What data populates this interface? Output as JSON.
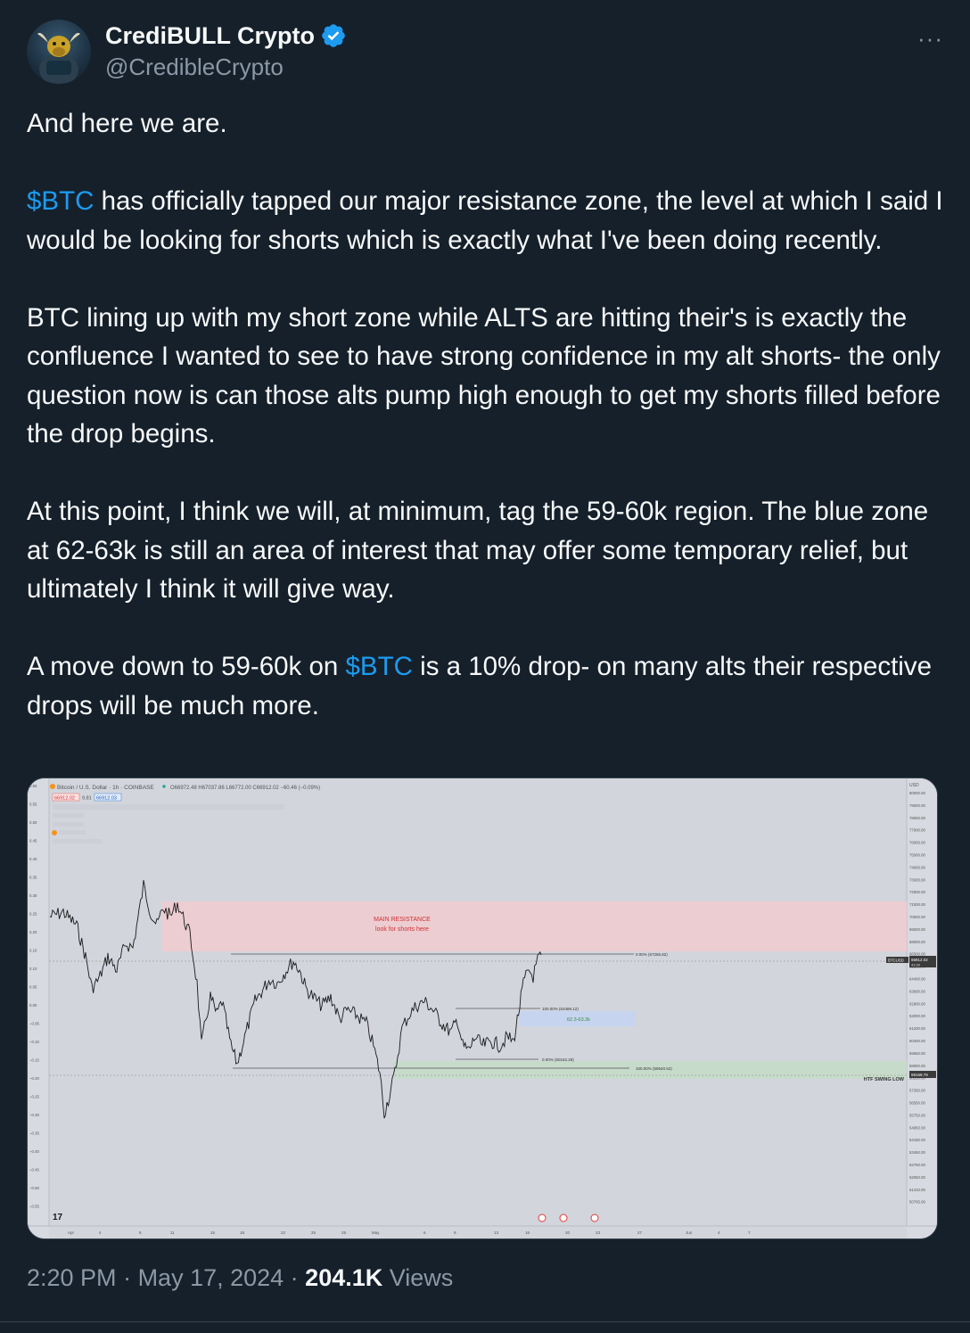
{
  "author": {
    "display_name": "CrediBULL Crypto",
    "handle": "@CredibleCrypto",
    "more_label": "···"
  },
  "tweet": {
    "p1": "And here we are.",
    "p2_tag": "$BTC",
    "p2_rest": " has officially tapped our major resistance zone, the level at which I said I would be looking for shorts which is exactly what I've been doing recently.",
    "p3": "BTC lining up with my short zone while ALTS are hitting their's is exactly the confluence I wanted to see to have strong confidence in my alt shorts- the only question now is can those alts pump high enough to get my shorts filled before the drop begins.",
    "p4": "At this point, I think we will, at minimum, tag the 59-60k region. The blue zone at 62-63k is still an area of interest that may offer some temporary relief, but ultimately I think it will give way.",
    "p5_pre": "A move down to 59-60k on ",
    "p5_tag": "$BTC",
    "p5_post": " is a 10% drop- on many alts their respective drops will be much more."
  },
  "meta": {
    "time": "2:20 PM",
    "date": "May 17, 2024",
    "sep": " · ",
    "views_count": "204.1K",
    "views_label": " Views"
  },
  "chart": {
    "symbol_header": "Bitcoin / U.S. Dollar · 1h · COINBASE",
    "ohlc": "O66972.48 H67037.86 L66772.00 C66912.02 −60.46 (−0.09%)",
    "price_box_1": "66912.02",
    "price_box_mid": "9.81",
    "price_box_2": "66912.03",
    "resistance_label_1": "MAIN RESISTANCE",
    "resistance_label_2": "look for shorts here",
    "fib_0_top": "0.00% (67265.82)",
    "fib_100_mid": "100.00% (63489.12)",
    "blue_zone_label": "62.3-63.3k",
    "fib_0_low": "0.00% (60162.28)",
    "fib_100_low": "100.00% (59540.52)",
    "htf_label": "HTF SWING LOW",
    "usd_label": "USD",
    "ticker_tag": "BTCUSD",
    "current_price": "66912.02",
    "current_time": "43:39",
    "low_tag": "59169.79",
    "price_ticks": [
      "80000.00",
      "79000.00",
      "78000.00",
      "77000.00",
      "76000.00",
      "75000.00",
      "74000.00",
      "73000.00",
      "72000.00",
      "71000.00",
      "70000.00",
      "69000.00",
      "68000.00",
      "66500.00",
      "65200.00",
      "64400.00",
      "63600.00",
      "62800.00",
      "62000.00",
      "61200.00",
      "60400.00",
      "59650.00",
      "58900.00",
      "58150.00",
      "57350.00",
      "56550.00",
      "55750.00",
      "54950.00",
      "54150.00",
      "53450.00",
      "52750.00",
      "52050.00",
      "51410.00",
      "50765.00"
    ],
    "left_ticks": [
      "0.60",
      "0.55",
      "0.50",
      "0.45",
      "0.40",
      "0.35",
      "0.30",
      "0.25",
      "0.20",
      "0.15",
      "0.10",
      "0.05",
      "0.00",
      "−0.05",
      "−0.10",
      "−0.15",
      "−0.20",
      "−0.25",
      "−0.30",
      "−0.35",
      "−0.40",
      "−0.45",
      "−0.50",
      "−0.55"
    ],
    "date_ticks": [
      "Apr",
      "4",
      "8",
      "11",
      "15",
      "18",
      "22",
      "25",
      "29",
      "May",
      "6",
      "9",
      "13",
      "16",
      "20",
      "23",
      "27",
      "Jun",
      "4",
      "7"
    ],
    "tv_logo": "17"
  }
}
